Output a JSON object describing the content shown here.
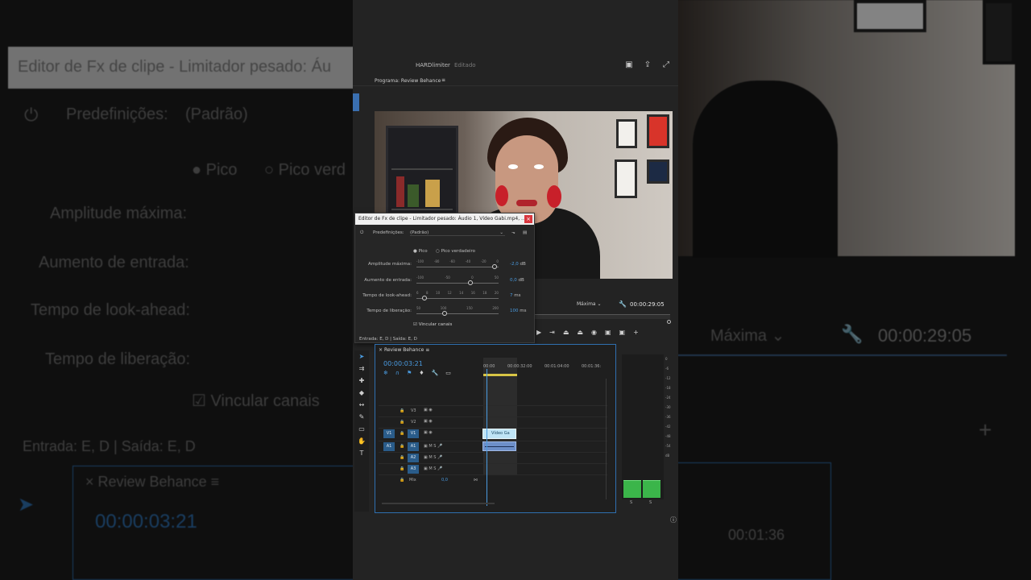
{
  "window": {
    "project_name": "HARDlimiter",
    "project_state": "Editado"
  },
  "program_monitor": {
    "title": "Programa: Review Behance",
    "zoom": "Máxima",
    "timecode": "00:00:29:05"
  },
  "effect_dialog": {
    "title": "Editor de Fx de clipe - Limitador pesado: Áudio 1, Vídeo Gabi.mp4, ...",
    "presets_label": "Predefinições:",
    "presets_value": "(Padrão)",
    "radio_peak": "Pico",
    "radio_true_peak": "Pico verdadeiro",
    "params": [
      {
        "label": "Amplitude máxima:",
        "ticks": [
          "-100",
          "-80",
          "-60",
          "-40",
          "-20",
          "0"
        ],
        "value": "-2,0",
        "unit": "dB",
        "level": 0.98
      },
      {
        "label": "Aumento de entrada:",
        "ticks": [
          "-100",
          "-50",
          "0",
          "50"
        ],
        "value": "0,0",
        "unit": "dB",
        "level": 0.67
      },
      {
        "label": "Tempo de look-ahead:",
        "ticks": [
          "6",
          "8",
          "10",
          "12",
          "14",
          "16",
          "18",
          "20"
        ],
        "value": "7",
        "unit": "ms",
        "level": 0.07
      },
      {
        "label": "Tempo de liberação:",
        "ticks": [
          "50",
          "100",
          "150",
          "200"
        ],
        "value": "100",
        "unit": "ms",
        "level": 0.33
      }
    ],
    "link_channels_label": "Vincular canais"
  },
  "status": {
    "entry_text": "Entrada: E, D | Saída: E, D"
  },
  "timeline": {
    "sequence_name": "Review Behance",
    "timecode": "00:00:03:21",
    "ruler": [
      "00:00",
      "00:00:32:00",
      "00:01:04:00",
      "00:01:36:"
    ],
    "video_tracks": [
      "V3",
      "V2",
      "V1"
    ],
    "audio_tracks": [
      "A1",
      "A2",
      "A3"
    ],
    "mix_label": "Mix",
    "mix_value": "0,0",
    "video_clip_label": "Vídeo Ga"
  },
  "meters": {
    "scale": [
      "0",
      "-6",
      "-12",
      "-18",
      "-24",
      "-30",
      "-36",
      "-42",
      "-48",
      "-54",
      "dB"
    ],
    "channels": [
      "S",
      "S"
    ]
  },
  "background": {
    "left": {
      "dialog_title": "Editor de Fx de clipe - Limitador pesado: Áu",
      "presets_label": "Predefinições:",
      "presets_value": "(Padrão)",
      "radio_peak": "Pico",
      "radio_true_peak": "Pico verd",
      "param1": "Amplitude máxima:",
      "param2": "Aumento de entrada:",
      "param3": "Tempo de look-ahead:",
      "param4": "Tempo de liberação:",
      "link": "Vincular canais",
      "entry": "Entrada: E, D | Saída: E, D",
      "sequence": "Review Behance",
      "timecode": "00:00:03:21"
    },
    "right": {
      "zoom": "Máxima",
      "timecode": "00:00:29:05",
      "ruler": "00:01:36"
    }
  }
}
